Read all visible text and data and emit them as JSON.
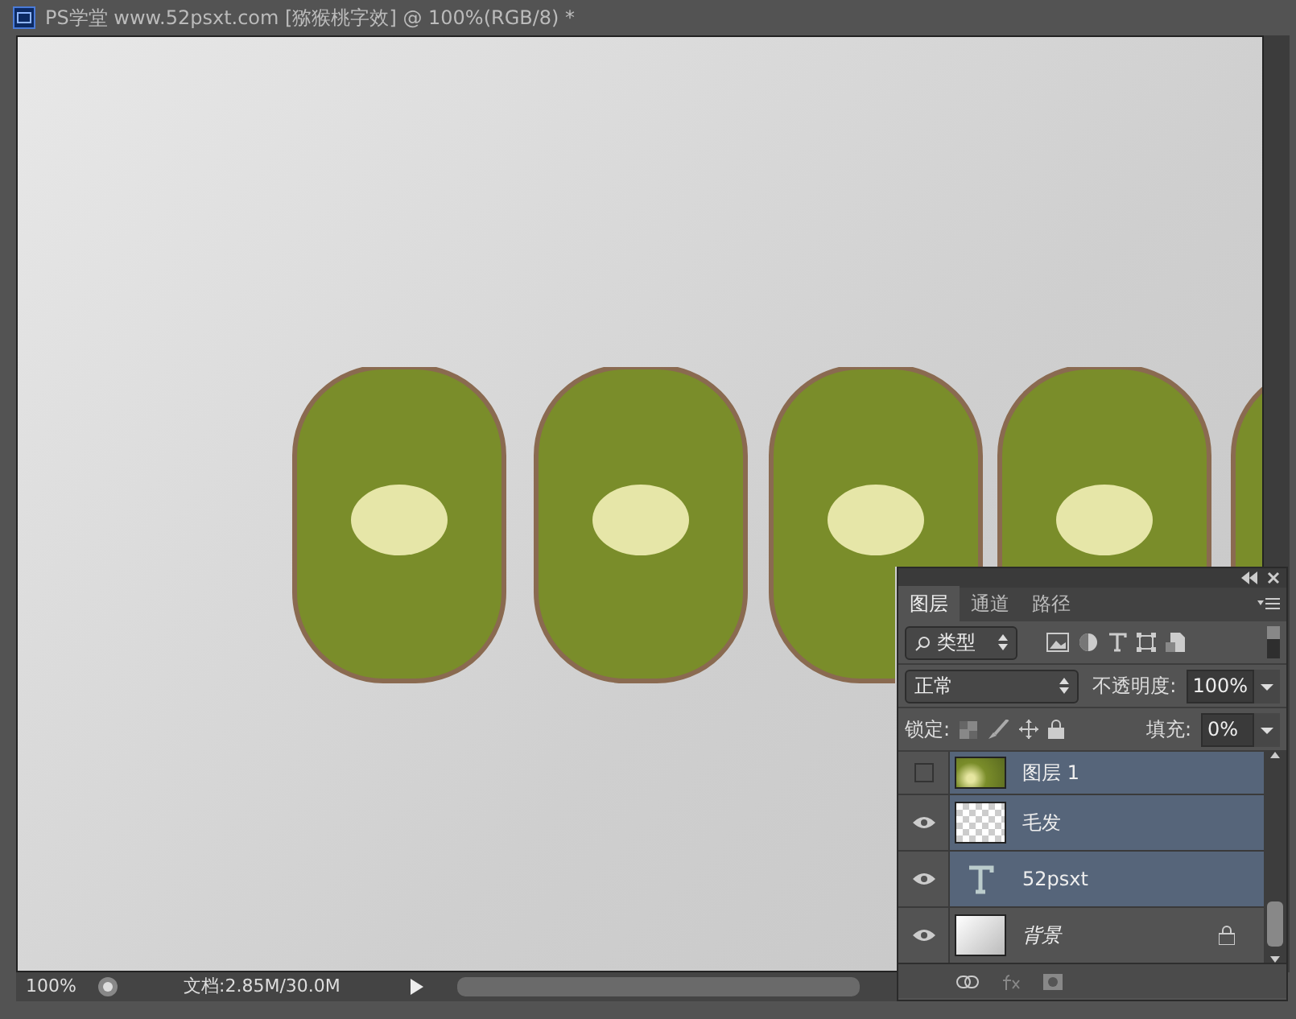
{
  "window": {
    "title": "PS学堂  www.52psxt.com [猕猴桃字效] @ 100%(RGB/8) *"
  },
  "status_bar": {
    "zoom": "100%",
    "doc_info": "文档:2.85M/30.0M"
  },
  "layers_panel": {
    "tabs": [
      {
        "label": "图层",
        "selected": true
      },
      {
        "label": "通道",
        "selected": false
      },
      {
        "label": "路径",
        "selected": false
      }
    ],
    "filter": {
      "value": "类型"
    },
    "blend_mode": {
      "value": "正常"
    },
    "opacity": {
      "label": "不透明度:",
      "value": "100%"
    },
    "lock_label": "锁定:",
    "fill": {
      "label": "填充:",
      "value": "0%"
    },
    "layers": [
      {
        "name": "图层 1",
        "kind": "image",
        "visible": false,
        "selected": true,
        "locked": false
      },
      {
        "name": "毛发",
        "kind": "transparent",
        "visible": true,
        "selected": true,
        "locked": false
      },
      {
        "name": "52psxt",
        "kind": "text",
        "visible": true,
        "selected": true,
        "locked": false
      },
      {
        "name": "背景",
        "kind": "background",
        "visible": true,
        "selected": false,
        "locked": true
      }
    ]
  }
}
